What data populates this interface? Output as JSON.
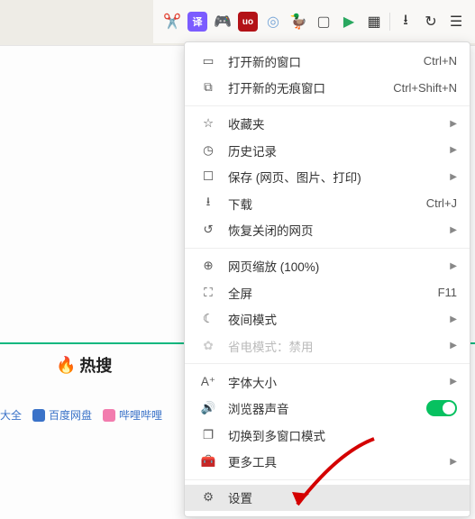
{
  "toolbar": {
    "icons": [
      "scissors",
      "translate",
      "gamepad",
      "shield",
      "swirl",
      "duck",
      "book",
      "store",
      "grid",
      "download",
      "reload",
      "menu"
    ]
  },
  "hot": {
    "label": "热搜"
  },
  "footer": {
    "items": [
      {
        "label": "大全"
      },
      {
        "label": "百度网盘"
      },
      {
        "label": "哔哩哔哩"
      }
    ]
  },
  "menu": {
    "new_window": {
      "label": "打开新的窗口",
      "shortcut": "Ctrl+N"
    },
    "new_incognito": {
      "label": "打开新的无痕窗口",
      "shortcut": "Ctrl+Shift+N"
    },
    "bookmarks": {
      "label": "收藏夹"
    },
    "history": {
      "label": "历史记录"
    },
    "save": {
      "label": "保存 (网页、图片、打印)"
    },
    "downloads": {
      "label": "下载",
      "shortcut": "Ctrl+J"
    },
    "restore_closed": {
      "label": "恢复关闭的网页"
    },
    "zoom": {
      "label": "网页缩放 (100%)"
    },
    "fullscreen": {
      "label": "全屏",
      "shortcut": "F11"
    },
    "night_mode": {
      "label": "夜间模式"
    },
    "power_save": {
      "label": "省电模式：禁用"
    },
    "font_size": {
      "label": "字体大小"
    },
    "browser_sound": {
      "label": "浏览器声音"
    },
    "multi_window": {
      "label": "切换到多窗口模式"
    },
    "more_tools": {
      "label": "更多工具"
    },
    "settings": {
      "label": "设置"
    }
  }
}
